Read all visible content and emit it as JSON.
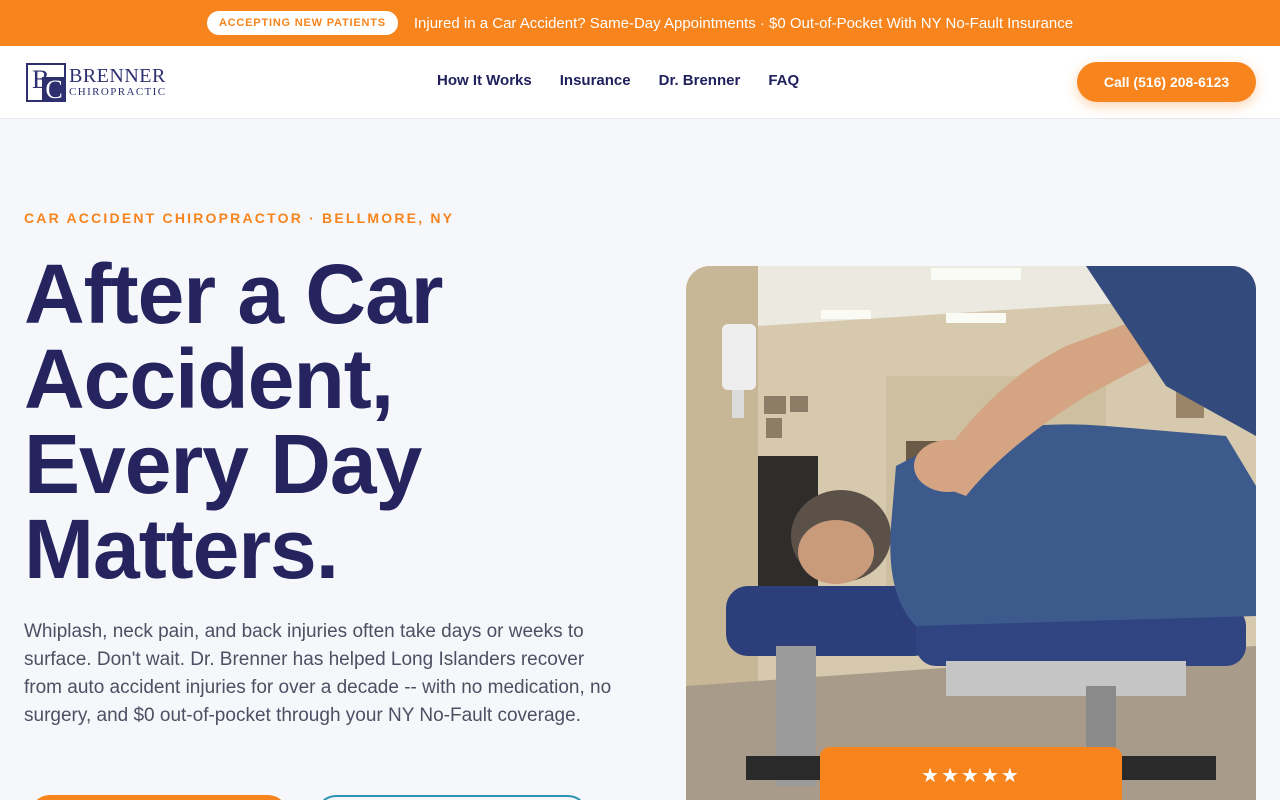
{
  "topbar": {
    "badge": "ACCEPTING NEW PATIENTS",
    "message": "Injured in a Car Accident? Same-Day Appointments · $0 Out-of-Pocket With NY No-Fault Insurance"
  },
  "header": {
    "logo": {
      "name": "BRENNER",
      "sub": "CHIROPRACTIC",
      "monogram_b": "B",
      "monogram_c": "C"
    },
    "nav": [
      "How It Works",
      "Insurance",
      "Dr. Brenner",
      "FAQ"
    ],
    "call_button": "Call (516) 208-6123"
  },
  "hero": {
    "eyebrow": "CAR ACCIDENT CHIROPRACTOR · BELLMORE, NY",
    "title_lines": [
      "After a Car",
      "Accident,",
      "Every Day",
      "Matters."
    ],
    "description": "Whiplash, neck pain, and back injuries often take days or weeks to surface. Don't wait. Dr. Brenner has helped Long Islanders recover from auto accident injuries for over a decade -- with no medication, no surgery, and $0 out-of-pocket through your NY No-Fault coverage."
  },
  "review_card": {
    "stars": "★★★★★",
    "rating": 5
  },
  "colors": {
    "accent": "#f7841d",
    "navy": "#25245f",
    "teal": "#2b95b5"
  },
  "icons": [
    "star-icon"
  ]
}
